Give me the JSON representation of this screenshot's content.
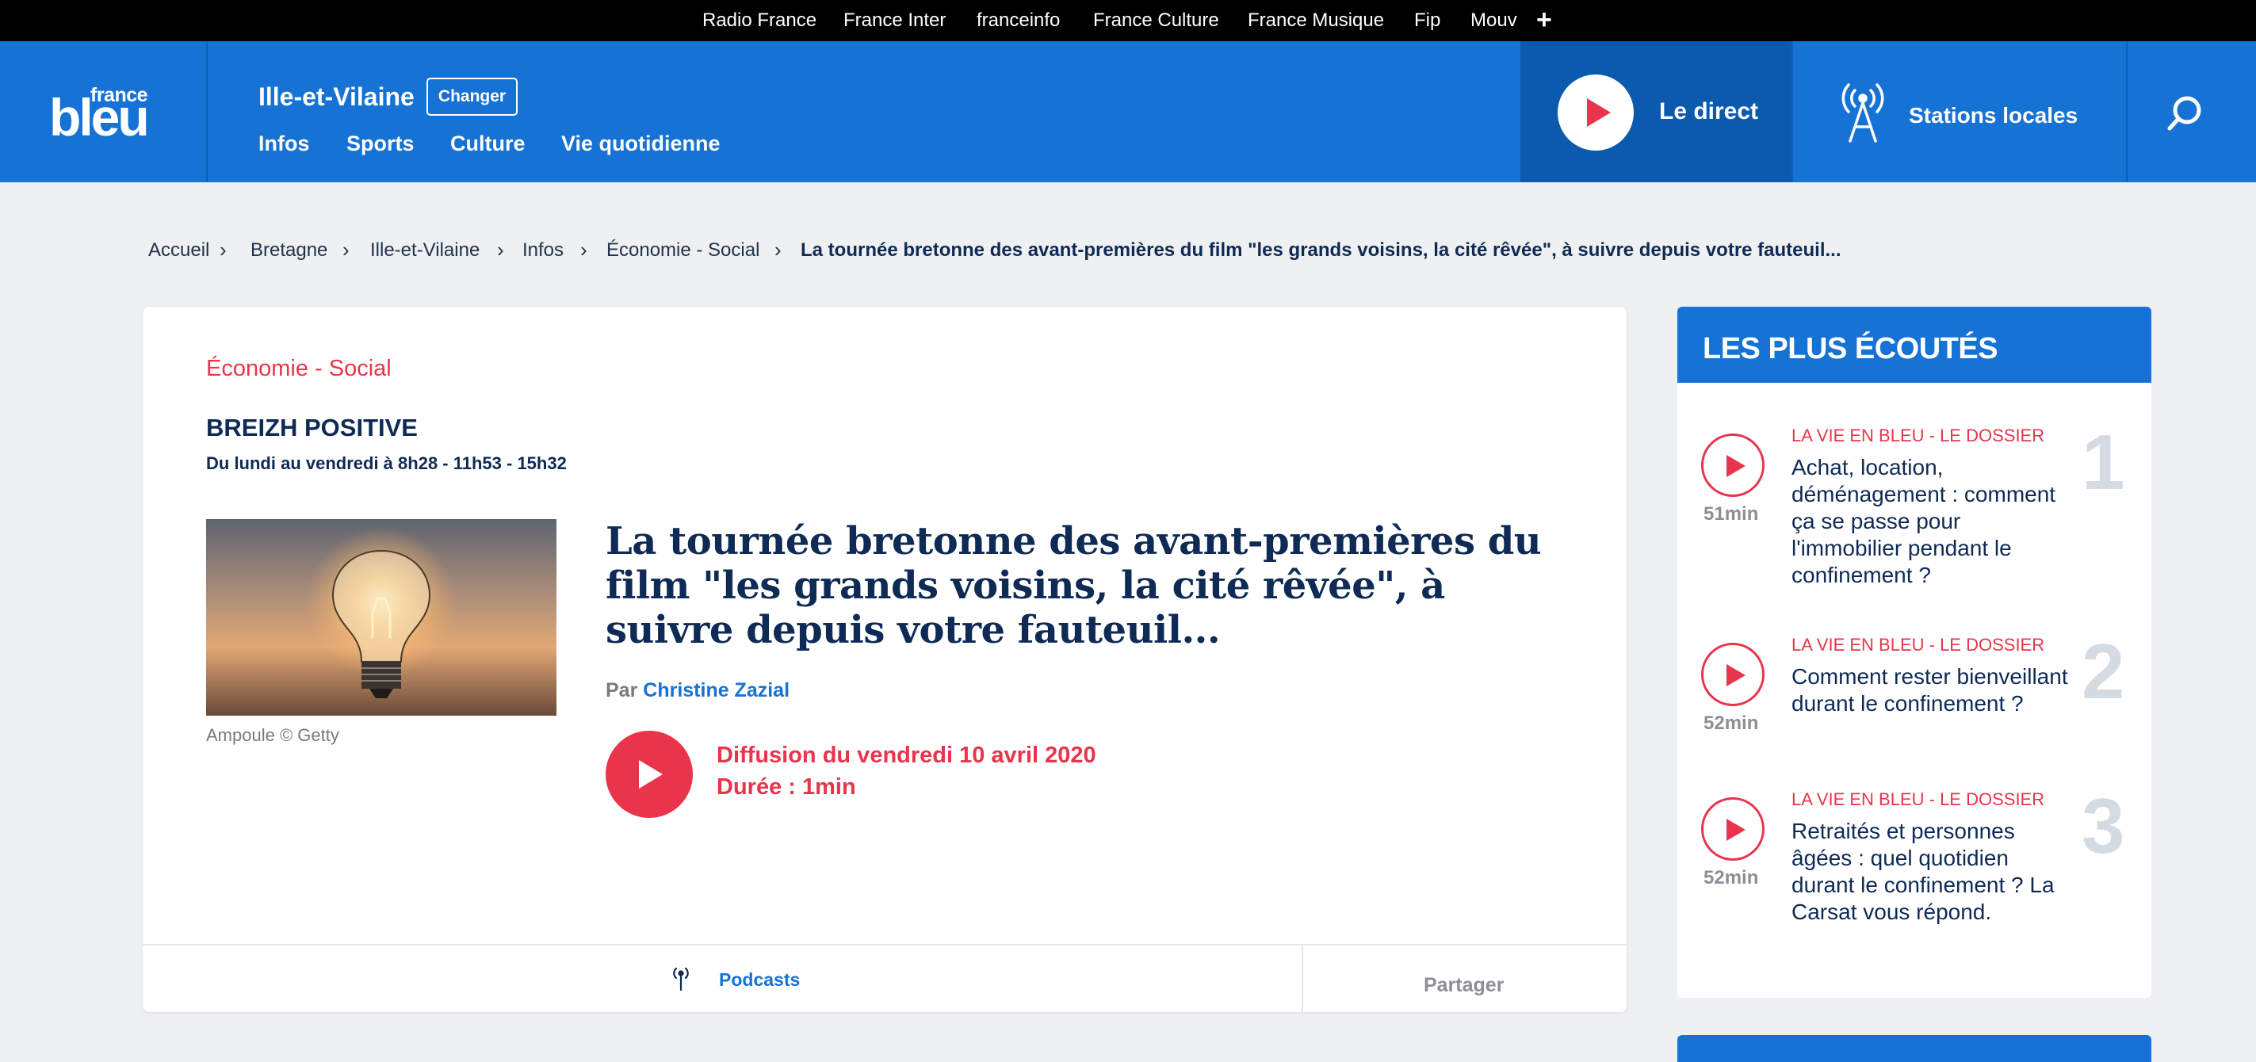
{
  "network": {
    "links": [
      "Radio France",
      "France Inter",
      "franceinfo",
      "France Culture",
      "France Musique",
      "Fip",
      "Mouv"
    ],
    "more_icon": "plus-icon"
  },
  "header": {
    "logo_top": "france",
    "logo_main": "bleu",
    "region": "Ille-et-Vilaine",
    "change_label": "Changer",
    "nav": [
      "Infos",
      "Sports",
      "Culture",
      "Vie quotidienne"
    ],
    "direct_label": "Le direct",
    "stations_label": "Stations locales",
    "brand_color": "#1672d4",
    "accent_color": "#e8354b"
  },
  "breadcrumb": {
    "items": [
      "Accueil",
      "Bretagne",
      "Ille-et-Vilaine",
      "Infos",
      "Économie - Social"
    ],
    "current": "La tournée bretonne des avant-premières du film \"les grands voisins, la cité rêvée\", à suivre depuis votre fauteuil..."
  },
  "article": {
    "category": "Économie - Social",
    "show_title": "BREIZH POSITIVE",
    "show_schedule": "Du lundi au vendredi à 8h28 - 11h53 - 15h32",
    "image_caption": "Ampoule © Getty",
    "title": "La tournée bretonne des avant-premières du film \"les grands voisins, la cité rêvée\", à suivre depuis votre fauteuil...",
    "byline_prefix": "Par",
    "author": "Christine Zazial",
    "diffusion": "Diffusion du vendredi 10 avril 2020",
    "duree": "Durée : 1min",
    "podcasts_label": "Podcasts",
    "share_label": "Partager"
  },
  "sidebar": {
    "title": "LES PLUS ÉCOUTÉS",
    "items": [
      {
        "rank": "1",
        "kicker": "LA VIE EN BLEU - LE DOSSIER",
        "text": "Achat, location, déménagement : comment ça se passe pour l'immobilier pendant le confinement ?",
        "duration": "51min"
      },
      {
        "rank": "2",
        "kicker": "LA VIE EN BLEU - LE DOSSIER",
        "text": "Comment rester bienveillant durant le confinement ?",
        "duration": "52min"
      },
      {
        "rank": "3",
        "kicker": "LA VIE EN BLEU - LE DOSSIER",
        "text": "Retraités et personnes âgées : quel quotidien durant le confinement ? La Carsat vous répond.",
        "duration": "52min"
      }
    ]
  }
}
